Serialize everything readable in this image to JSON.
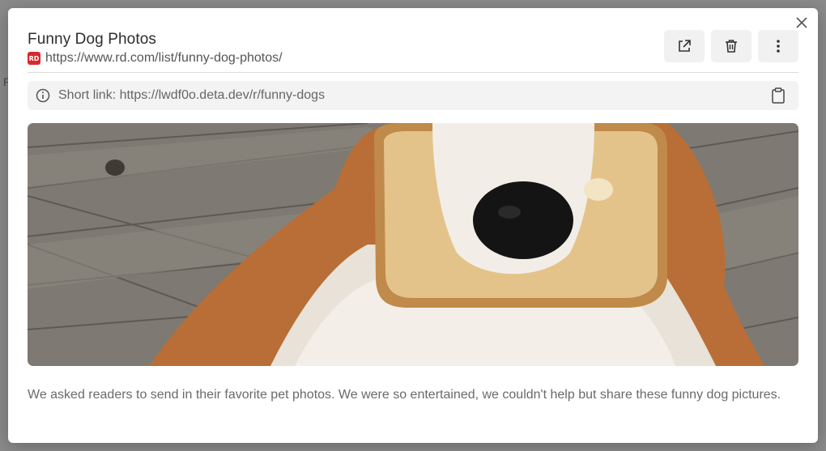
{
  "backdrop": {
    "peek_letter": "R"
  },
  "modal": {
    "title": "Funny Dog Photos",
    "url": "https://www.rd.com/list/funny-dog-photos/",
    "favicon": "RD",
    "actions": [
      {
        "icon": "external-link-icon"
      },
      {
        "icon": "trash-icon"
      },
      {
        "icon": "more-vertical-icon"
      }
    ],
    "short_link": "Short link: https://lwdf0o.deta.dev/r/funny-dogs",
    "description": "We asked readers to send in their favorite pet photos. We were so entertained, we couldn't help but share these funny dog pictures."
  },
  "colors": {
    "accent_favicon": "#d8282c",
    "action_bg": "#f1f1f1",
    "shortlink_bg": "#f3f3f3"
  }
}
